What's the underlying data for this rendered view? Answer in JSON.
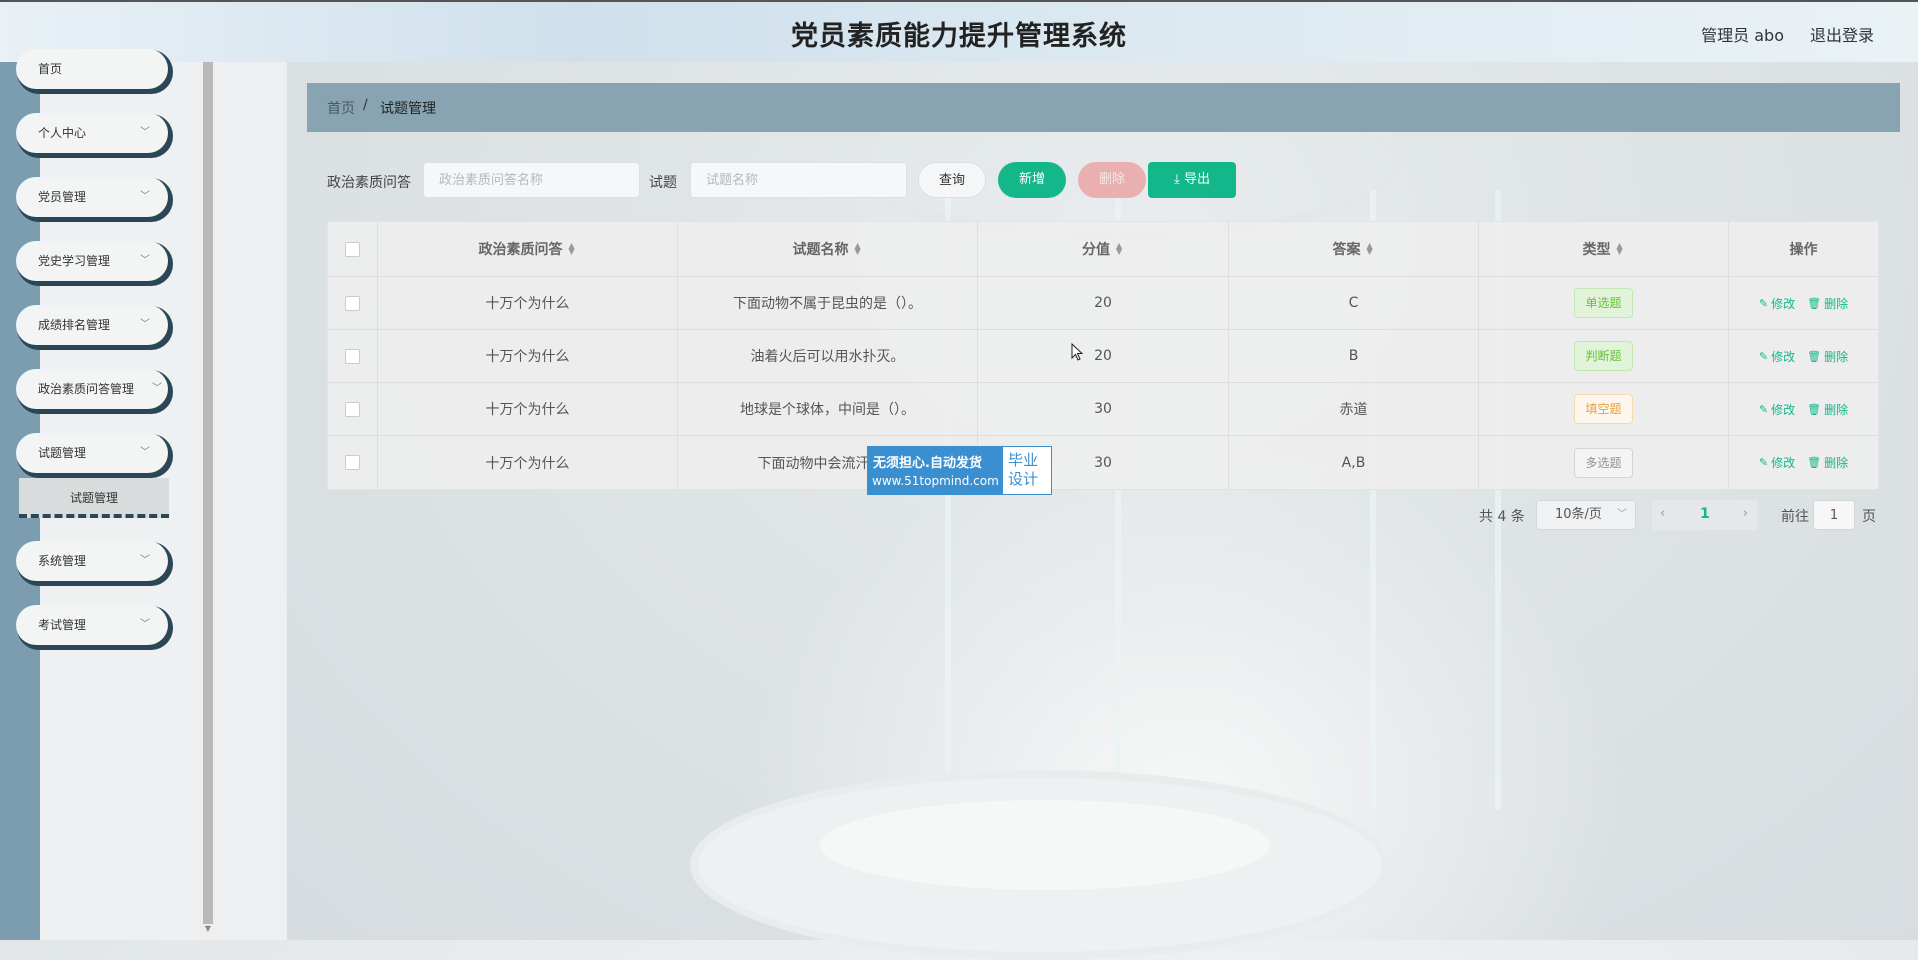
{
  "header": {
    "title": "党员素质能力提升管理系统",
    "user": "管理员 abo",
    "logout": "退出登录"
  },
  "sidebar": {
    "items": [
      {
        "label": "首页",
        "has_children": false
      },
      {
        "label": "个人中心",
        "has_children": true
      },
      {
        "label": "党员管理",
        "has_children": true
      },
      {
        "label": "党史学习管理",
        "has_children": true
      },
      {
        "label": "成绩排名管理",
        "has_children": true
      },
      {
        "label": "政治素质问答管理",
        "has_children": true
      },
      {
        "label": "试题管理",
        "has_children": true,
        "expanded": true
      },
      {
        "label": "系统管理",
        "has_children": true
      },
      {
        "label": "考试管理",
        "has_children": true
      }
    ],
    "submenu": {
      "label": "试题管理"
    }
  },
  "breadcrumb": {
    "home": "首页",
    "separator": "/",
    "current": "试题管理"
  },
  "search": {
    "field1_label": "政治素质问答",
    "field1_placeholder": "政治素质问答名称",
    "field2_label": "试题",
    "field2_placeholder": "试题名称",
    "query": "查询",
    "add": "新增",
    "delete": "删除",
    "export": "导出"
  },
  "table": {
    "columns": [
      "政治素质问答",
      "试题名称",
      "分值",
      "答案",
      "类型",
      "操作"
    ],
    "rows": [
      {
        "qa": "十万个为什么",
        "name": "下面动物不属于昆虫的是（）。",
        "score": "20",
        "answer": "C",
        "type": "单选题",
        "type_color": "#67c23a"
      },
      {
        "qa": "十万个为什么",
        "name": "油着火后可以用水扑灭。",
        "score": "20",
        "answer": "B",
        "type": "判断题",
        "type_color": "#67c23a"
      },
      {
        "qa": "十万个为什么",
        "name": "地球是个球体，中间是（）。",
        "score": "30",
        "answer": "赤道",
        "type": "填空题",
        "type_color": "#e6a23c"
      },
      {
        "qa": "十万个为什么",
        "name": "下面动物中会流汗的有",
        "score": "30",
        "answer": "A,B",
        "type": "多选题",
        "type_color": "#909399"
      }
    ],
    "edit": "修改",
    "remove": "删除"
  },
  "pagination": {
    "total": "共 4 条",
    "page_size": "10条/页",
    "current_page": "1",
    "goto_label": "前往",
    "goto_value": "1",
    "page_suffix": "页"
  },
  "watermark": {
    "line1": "无须担心.自动发货",
    "line2": "www.51topmind.com",
    "side": "毕业设计"
  },
  "colors": {
    "accent": "#13b78a",
    "sidebar_dark": "#2b4657",
    "breadcrumb": "#88a4b3"
  }
}
